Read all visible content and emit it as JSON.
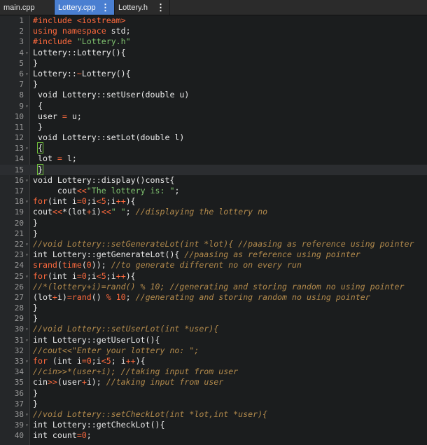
{
  "tabs": [
    {
      "label": "main.cpp",
      "active": false,
      "menu": ""
    },
    {
      "label": "Lottery.cpp",
      "active": true,
      "menu": "⋮"
    },
    {
      "label": "Lottery.h",
      "active": false,
      "menu": "⋮"
    }
  ],
  "colors": {
    "keyword": "#ff6a3d",
    "string": "#7fc26f",
    "comment": "#b28a4c",
    "text": "#eaeaea",
    "tab_active": "#4a7fd1"
  },
  "editor": {
    "lines": [
      {
        "n": "1",
        "fold": false,
        "tokens": [
          [
            "pp",
            "#include <iostream>"
          ]
        ]
      },
      {
        "n": "2",
        "fold": false,
        "tokens": [
          [
            "kw",
            "using namespace"
          ],
          [
            "pl",
            " std;"
          ]
        ]
      },
      {
        "n": "3",
        "fold": false,
        "tokens": [
          [
            "pp",
            "#include "
          ],
          [
            "str",
            "\"Lottery.h\""
          ]
        ]
      },
      {
        "n": "4",
        "fold": true,
        "tokens": [
          [
            "pl",
            "Lottery::Lottery(){"
          ]
        ]
      },
      {
        "n": "5",
        "fold": false,
        "tokens": [
          [
            "pl",
            "}"
          ]
        ]
      },
      {
        "n": "6",
        "fold": true,
        "tokens": [
          [
            "pl",
            "Lottery::"
          ],
          [
            "op",
            "~"
          ],
          [
            "pl",
            "Lottery(){"
          ]
        ]
      },
      {
        "n": "7",
        "fold": false,
        "tokens": [
          [
            "pl",
            "}"
          ]
        ]
      },
      {
        "n": "8",
        "fold": false,
        "tokens": [
          [
            "pl",
            " void Lottery::setUser(double u)"
          ]
        ]
      },
      {
        "n": "9",
        "fold": true,
        "tokens": [
          [
            "pl",
            " {"
          ]
        ]
      },
      {
        "n": "10",
        "fold": false,
        "tokens": [
          [
            "pl",
            " user "
          ],
          [
            "op",
            "="
          ],
          [
            "pl",
            " u;"
          ]
        ]
      },
      {
        "n": "11",
        "fold": false,
        "tokens": [
          [
            "pl",
            " }"
          ]
        ]
      },
      {
        "n": "12",
        "fold": false,
        "tokens": [
          [
            "pl",
            " void Lottery::setLot(double l)"
          ]
        ]
      },
      {
        "n": "13",
        "fold": true,
        "tokens": [
          [
            "pl",
            " "
          ],
          [
            "br",
            "{"
          ]
        ]
      },
      {
        "n": "14",
        "fold": false,
        "tokens": [
          [
            "pl",
            " lot "
          ],
          [
            "op",
            "="
          ],
          [
            "pl",
            " l;"
          ]
        ]
      },
      {
        "n": "15",
        "fold": false,
        "current": true,
        "tokens": [
          [
            "pl",
            " "
          ],
          [
            "br",
            "}"
          ]
        ]
      },
      {
        "n": "16",
        "fold": true,
        "tokens": [
          [
            "pl",
            "void Lottery::display()const{"
          ]
        ]
      },
      {
        "n": "17",
        "fold": false,
        "tokens": [
          [
            "pl",
            "     cout"
          ],
          [
            "op",
            "<<"
          ],
          [
            "str",
            "\"The lottery is: \""
          ],
          [
            "pl",
            ";"
          ]
        ]
      },
      {
        "n": "18",
        "fold": true,
        "tokens": [
          [
            "kw",
            "for"
          ],
          [
            "pl",
            "(int i"
          ],
          [
            "op",
            "="
          ],
          [
            "num",
            "0"
          ],
          [
            "pl",
            ";i"
          ],
          [
            "op",
            "<"
          ],
          [
            "num",
            "5"
          ],
          [
            "pl",
            ";i"
          ],
          [
            "op",
            "++"
          ],
          [
            "pl",
            "){"
          ]
        ]
      },
      {
        "n": "19",
        "fold": false,
        "tokens": [
          [
            "pl",
            "cout"
          ],
          [
            "op",
            "<<"
          ],
          [
            "pl",
            "*(lot"
          ],
          [
            "op",
            "+"
          ],
          [
            "pl",
            "i)"
          ],
          [
            "op",
            "<<"
          ],
          [
            "str",
            "\" \""
          ],
          [
            "pl",
            "; "
          ],
          [
            "cm",
            "//displaying the lottery no"
          ]
        ]
      },
      {
        "n": "20",
        "fold": false,
        "tokens": [
          [
            "pl",
            "}"
          ]
        ]
      },
      {
        "n": "21",
        "fold": false,
        "tokens": [
          [
            "pl",
            "}"
          ]
        ]
      },
      {
        "n": "22",
        "fold": true,
        "tokens": [
          [
            "cm",
            "//void Lottery::setGenerateLot(int *lot){ //paasing as reference using pointer"
          ]
        ]
      },
      {
        "n": "23",
        "fold": true,
        "tokens": [
          [
            "pl",
            "int Lottery::getGenerateLot(){ "
          ],
          [
            "cm",
            "//paasing as reference using pointer"
          ]
        ]
      },
      {
        "n": "24",
        "fold": false,
        "tokens": [
          [
            "fn",
            "srand"
          ],
          [
            "pl",
            "("
          ],
          [
            "fn",
            "time"
          ],
          [
            "pl",
            "("
          ],
          [
            "num",
            "0"
          ],
          [
            "pl",
            ")); "
          ],
          [
            "cm",
            "//to generate different no on every run"
          ]
        ]
      },
      {
        "n": "25",
        "fold": true,
        "tokens": [
          [
            "kw",
            "for"
          ],
          [
            "pl",
            "(int i"
          ],
          [
            "op",
            "="
          ],
          [
            "num",
            "0"
          ],
          [
            "pl",
            ";i"
          ],
          [
            "op",
            "<"
          ],
          [
            "num",
            "5"
          ],
          [
            "pl",
            ";i"
          ],
          [
            "op",
            "++"
          ],
          [
            "pl",
            "){"
          ]
        ]
      },
      {
        "n": "26",
        "fold": false,
        "tokens": [
          [
            "cm",
            "//*(lottery+i)=rand() % 10; //generating and storing random no using pointer"
          ]
        ]
      },
      {
        "n": "27",
        "fold": false,
        "tokens": [
          [
            "pl",
            "(lot"
          ],
          [
            "op",
            "+"
          ],
          [
            "pl",
            "i)"
          ],
          [
            "op",
            "="
          ],
          [
            "fn",
            "rand"
          ],
          [
            "pl",
            "() "
          ],
          [
            "op",
            "%"
          ],
          [
            "pl",
            " "
          ],
          [
            "num",
            "10"
          ],
          [
            "pl",
            "; "
          ],
          [
            "cm",
            "//generating and storing random no using pointer"
          ]
        ]
      },
      {
        "n": "28",
        "fold": false,
        "tokens": [
          [
            "pl",
            "}"
          ]
        ]
      },
      {
        "n": "29",
        "fold": false,
        "tokens": [
          [
            "pl",
            "}"
          ]
        ]
      },
      {
        "n": "30",
        "fold": true,
        "tokens": [
          [
            "cm",
            "//void Lottery::setUserLot(int *user){"
          ]
        ]
      },
      {
        "n": "31",
        "fold": true,
        "tokens": [
          [
            "pl",
            "int Lottery::getUserLot(){"
          ]
        ]
      },
      {
        "n": "32",
        "fold": false,
        "tokens": [
          [
            "cm",
            "//cout<<\"Enter your lottery no: \";"
          ]
        ]
      },
      {
        "n": "33",
        "fold": true,
        "tokens": [
          [
            "kw",
            "for"
          ],
          [
            "pl",
            " (int i"
          ],
          [
            "op",
            "="
          ],
          [
            "num",
            "0"
          ],
          [
            "pl",
            ";i"
          ],
          [
            "op",
            "<"
          ],
          [
            "num",
            "5"
          ],
          [
            "pl",
            "; i"
          ],
          [
            "op",
            "++"
          ],
          [
            "pl",
            "){"
          ]
        ]
      },
      {
        "n": "34",
        "fold": false,
        "tokens": [
          [
            "cm",
            "//cin>>*(user+i); //taking input from user"
          ]
        ]
      },
      {
        "n": "35",
        "fold": false,
        "tokens": [
          [
            "pl",
            "cin"
          ],
          [
            "op",
            ">>"
          ],
          [
            "pl",
            "(user"
          ],
          [
            "op",
            "+"
          ],
          [
            "pl",
            "i); "
          ],
          [
            "cm",
            "//taking input from user"
          ]
        ]
      },
      {
        "n": "36",
        "fold": false,
        "tokens": [
          [
            "pl",
            "}"
          ]
        ]
      },
      {
        "n": "37",
        "fold": false,
        "tokens": [
          [
            "pl",
            "}"
          ]
        ]
      },
      {
        "n": "38",
        "fold": true,
        "tokens": [
          [
            "cm",
            "//void Lottery::setCheckLot(int *lot,int *user){"
          ]
        ]
      },
      {
        "n": "39",
        "fold": true,
        "tokens": [
          [
            "pl",
            "int Lottery::getCheckLot(){"
          ]
        ]
      },
      {
        "n": "40",
        "fold": false,
        "tokens": [
          [
            "pl",
            "int count"
          ],
          [
            "op",
            "="
          ],
          [
            "num",
            "0"
          ],
          [
            "pl",
            ";"
          ]
        ]
      }
    ]
  }
}
